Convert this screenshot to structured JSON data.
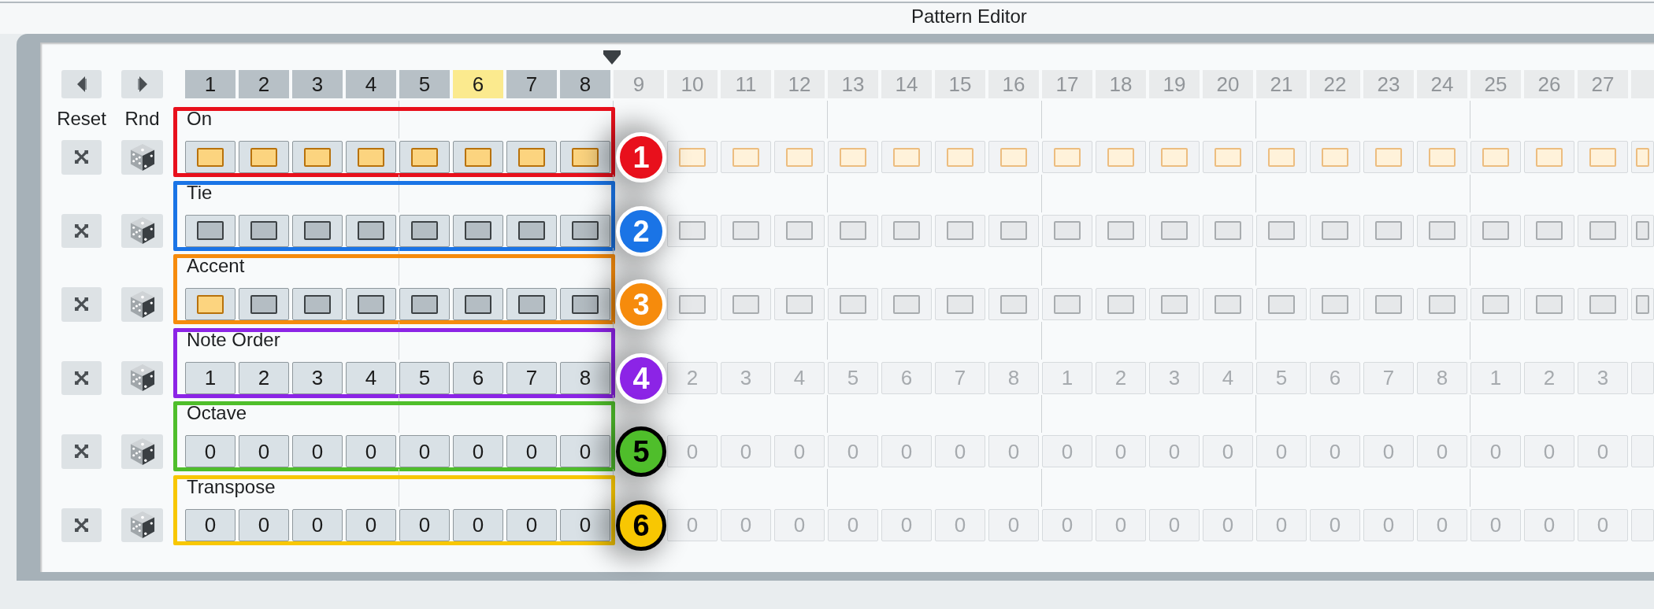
{
  "window": {
    "title": "Pattern Editor"
  },
  "column_headings": [
    "Reset",
    "Rnd"
  ],
  "steps": [
    {
      "label": "1",
      "highlighted": false,
      "disabled": false,
      "under_callout": false
    },
    {
      "label": "2",
      "highlighted": false,
      "disabled": false,
      "under_callout": false
    },
    {
      "label": "3",
      "highlighted": false,
      "disabled": false,
      "under_callout": false
    },
    {
      "label": "4",
      "highlighted": false,
      "disabled": false,
      "under_callout": false
    },
    {
      "label": "5",
      "highlighted": false,
      "disabled": false,
      "under_callout": false
    },
    {
      "label": "6",
      "highlighted": true,
      "disabled": false,
      "under_callout": false
    },
    {
      "label": "7",
      "highlighted": false,
      "disabled": false,
      "under_callout": false
    },
    {
      "label": "8",
      "highlighted": false,
      "disabled": false,
      "under_callout": false
    },
    {
      "label": "9",
      "highlighted": false,
      "disabled": true,
      "under_callout": true
    },
    {
      "label": "10",
      "highlighted": false,
      "disabled": true,
      "under_callout": false
    },
    {
      "label": "11",
      "highlighted": false,
      "disabled": true,
      "under_callout": false
    },
    {
      "label": "12",
      "highlighted": false,
      "disabled": true,
      "under_callout": false
    },
    {
      "label": "13",
      "highlighted": false,
      "disabled": true,
      "under_callout": false
    },
    {
      "label": "14",
      "highlighted": false,
      "disabled": true,
      "under_callout": false
    },
    {
      "label": "15",
      "highlighted": false,
      "disabled": true,
      "under_callout": false
    },
    {
      "label": "16",
      "highlighted": false,
      "disabled": true,
      "under_callout": false
    },
    {
      "label": "17",
      "highlighted": false,
      "disabled": true,
      "under_callout": false
    },
    {
      "label": "18",
      "highlighted": false,
      "disabled": true,
      "under_callout": false
    },
    {
      "label": "19",
      "highlighted": false,
      "disabled": true,
      "under_callout": false
    },
    {
      "label": "20",
      "highlighted": false,
      "disabled": true,
      "under_callout": false
    },
    {
      "label": "21",
      "highlighted": false,
      "disabled": true,
      "under_callout": false
    },
    {
      "label": "22",
      "highlighted": false,
      "disabled": true,
      "under_callout": false
    },
    {
      "label": "23",
      "highlighted": false,
      "disabled": true,
      "under_callout": false
    },
    {
      "label": "24",
      "highlighted": false,
      "disabled": true,
      "under_callout": false
    },
    {
      "label": "25",
      "highlighted": false,
      "disabled": true,
      "under_callout": false
    },
    {
      "label": "26",
      "highlighted": false,
      "disabled": true,
      "under_callout": false
    },
    {
      "label": "27",
      "highlighted": false,
      "disabled": true,
      "under_callout": false
    },
    {
      "highlighted": false,
      "disabled": true,
      "under_callout": false
    }
  ],
  "rows": [
    {
      "label": "On",
      "kind": "toggle",
      "checked": [
        true,
        true,
        true,
        true,
        true,
        true,
        true,
        true,
        true,
        true,
        true,
        true,
        true,
        true,
        true,
        true,
        true,
        true,
        true,
        true,
        true,
        true,
        true,
        true,
        true,
        true,
        true
      ],
      "callout": {
        "number": "1",
        "color": "#e8101c",
        "kind": "standard"
      }
    },
    {
      "label": "Tie",
      "kind": "toggle",
      "checked": [
        false,
        false,
        false,
        false,
        false,
        false,
        false,
        false,
        false,
        false,
        false,
        false,
        false,
        false,
        false,
        false,
        false,
        false,
        false,
        false,
        false,
        false,
        false,
        false,
        false,
        false,
        false
      ],
      "callout": {
        "number": "2",
        "color": "#1a74e6",
        "kind": "standard"
      }
    },
    {
      "label": "Accent",
      "kind": "toggle",
      "checked": [
        true,
        false,
        false,
        false,
        false,
        false,
        false,
        false,
        false,
        false,
        false,
        false,
        false,
        false,
        false,
        false,
        false,
        false,
        false,
        false,
        false,
        false,
        false,
        false,
        false,
        false,
        false
      ],
      "callout": {
        "number": "3",
        "color": "#f68b0c",
        "kind": "standard"
      }
    },
    {
      "label": "Note Order",
      "kind": "value",
      "values": [
        "1",
        "2",
        "3",
        "4",
        "5",
        "6",
        "7",
        "8",
        "2",
        "3",
        "4",
        "5",
        "6",
        "7",
        "8",
        "1",
        "2",
        "3",
        "4",
        "5",
        "6",
        "7",
        "8",
        "1",
        "2",
        "3"
      ],
      "callout": {
        "number": "4",
        "color": "#8c24e6",
        "kind": "standard"
      }
    },
    {
      "label": "Octave",
      "kind": "value",
      "values": [
        "0",
        "0",
        "0",
        "0",
        "0",
        "0",
        "0",
        "0",
        "0",
        "0",
        "0",
        "0",
        "0",
        "0",
        "0",
        "0",
        "0",
        "0",
        "0",
        "0",
        "0",
        "0",
        "0",
        "0",
        "0",
        "0"
      ],
      "callout": {
        "number": "5",
        "color": "#4fbe2b",
        "kind": "outlined"
      }
    },
    {
      "label": "Transpose",
      "kind": "value",
      "values": [
        "0",
        "0",
        "0",
        "0",
        "0",
        "0",
        "0",
        "0",
        "0",
        "0",
        "0",
        "0",
        "0",
        "0",
        "0",
        "0",
        "0",
        "0",
        "0",
        "0",
        "0",
        "0",
        "0",
        "0",
        "0",
        "0"
      ],
      "callout": {
        "number": "6",
        "color": "#f8c702",
        "kind": "outlined"
      }
    }
  ]
}
